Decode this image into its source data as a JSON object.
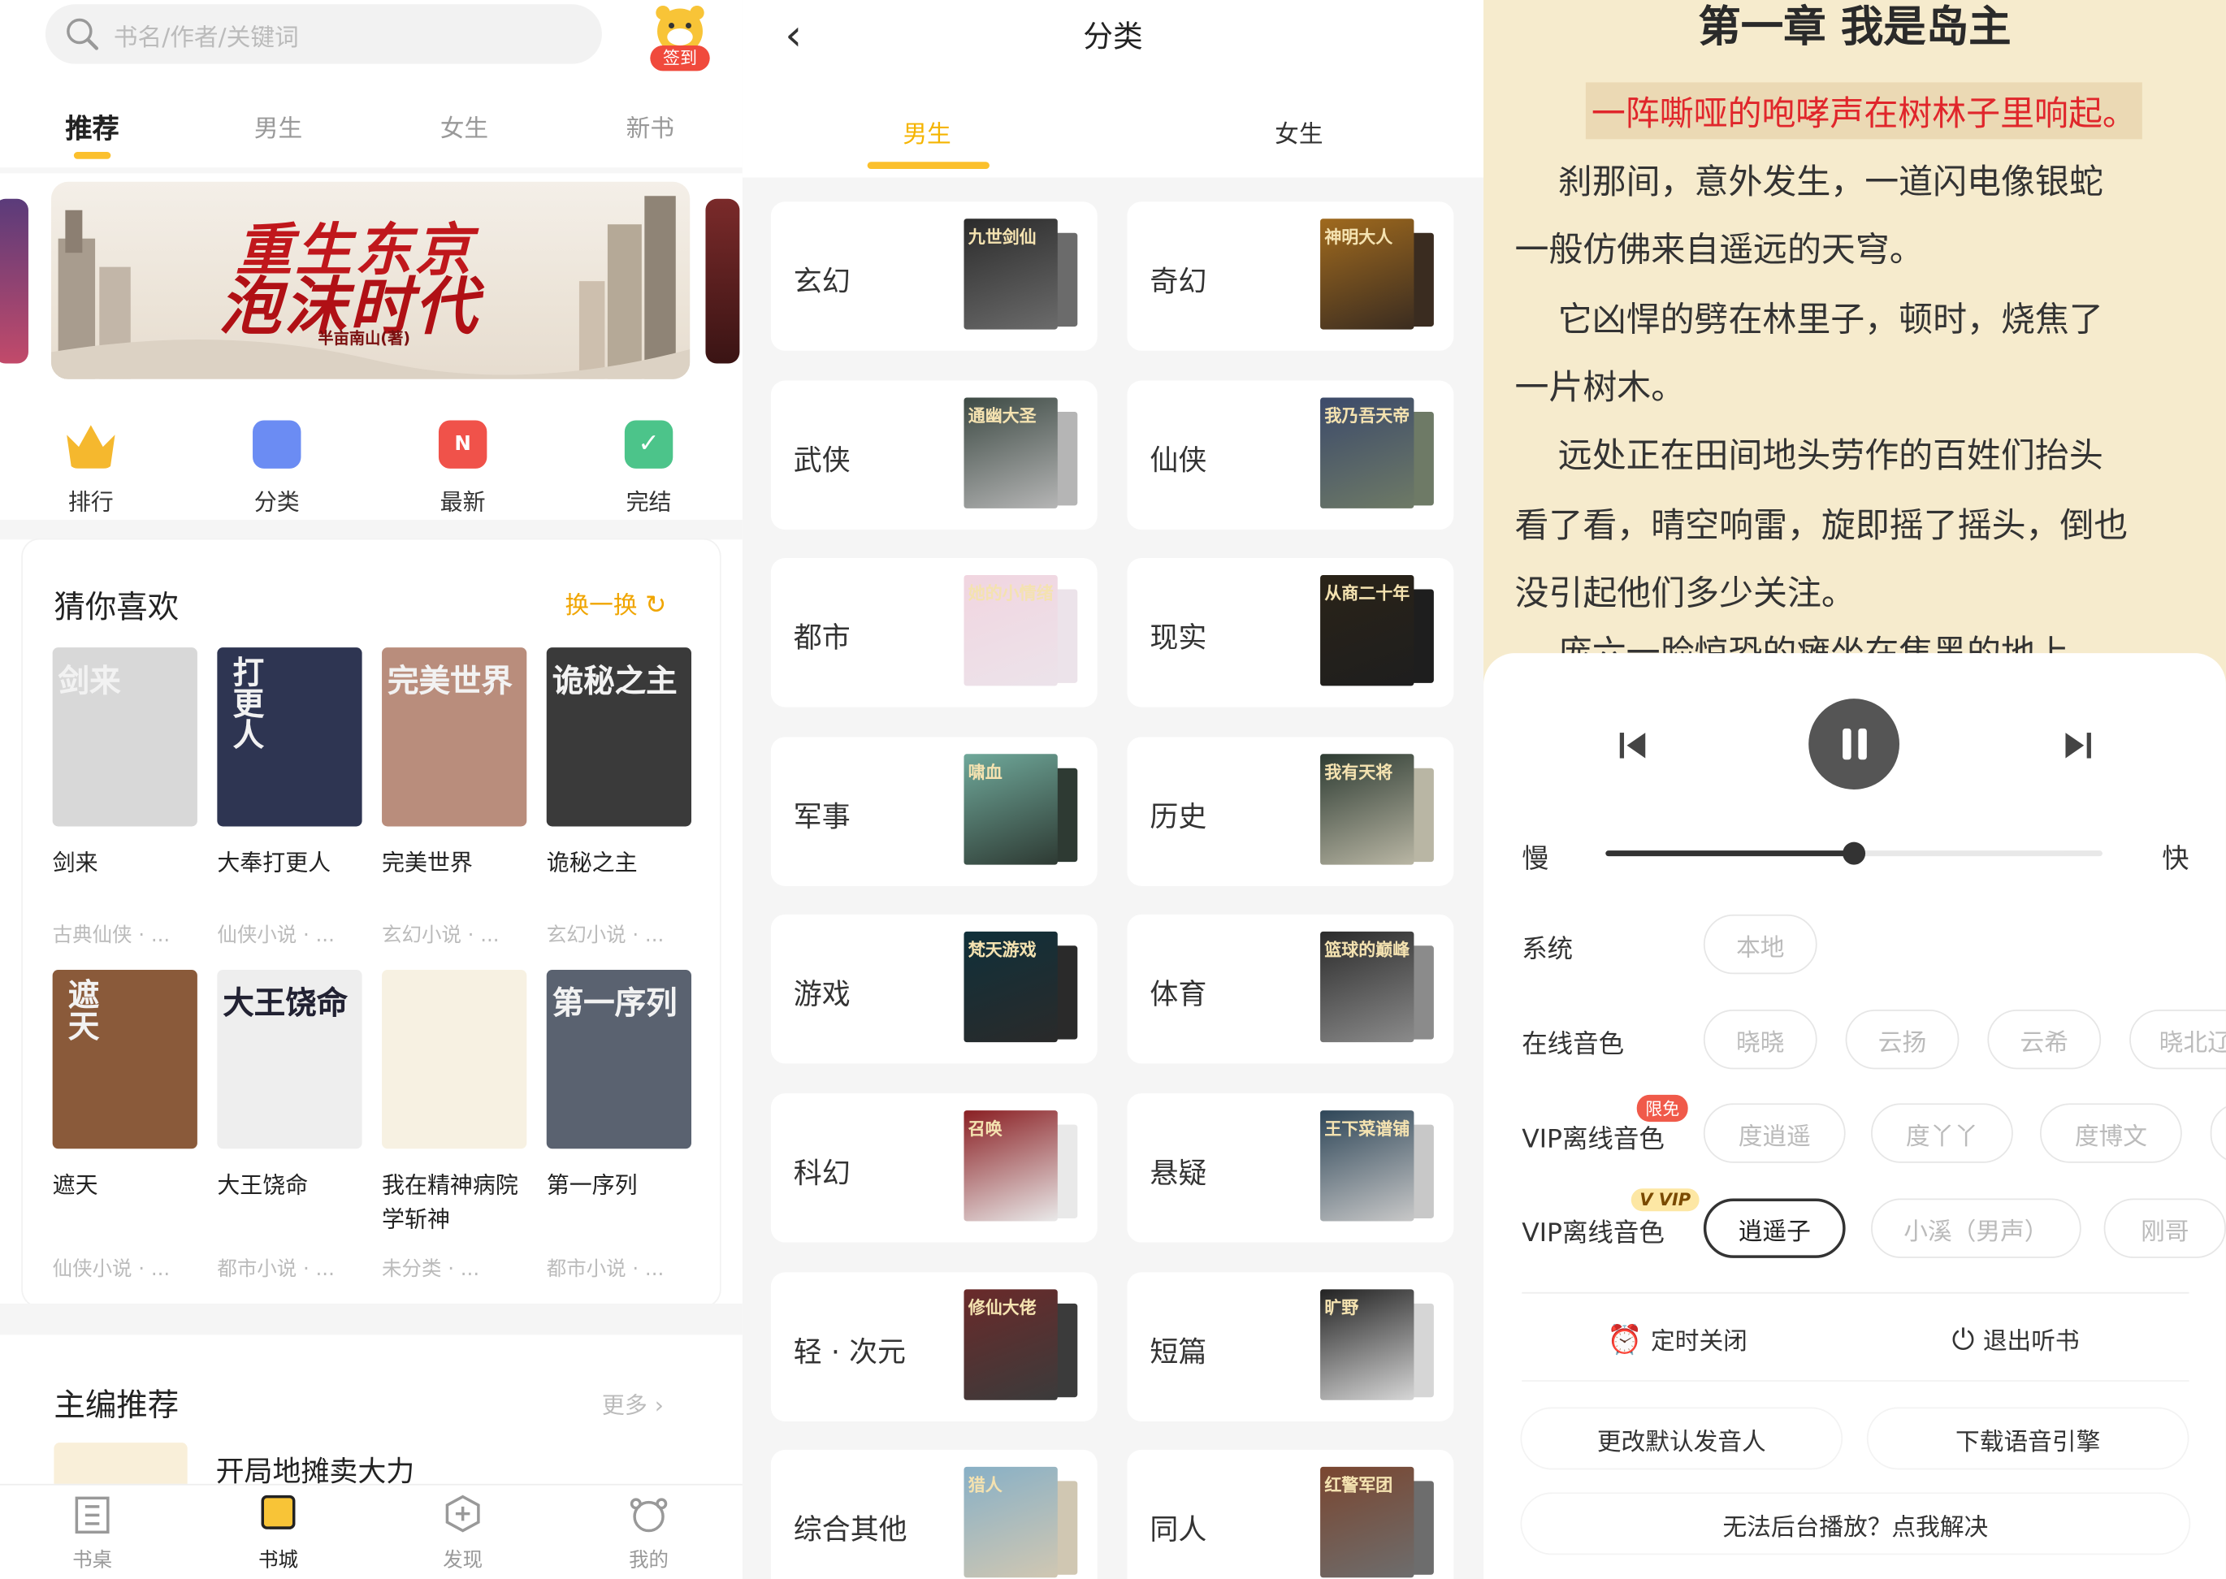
{
  "bookstore": {
    "search_placeholder": "书名/作者/关键词",
    "signin_label": "签到",
    "tabs": [
      "推荐",
      "男生",
      "女生",
      "新书"
    ],
    "banner_title_line1": "重生东京",
    "banner_title_line2": "泡沫时代",
    "banner_author": "半亩南山(著)",
    "quick_links": [
      {
        "label": "排行",
        "icon": "crown-icon",
        "color": "#f5b82e"
      },
      {
        "label": "分类",
        "icon": "category-icon",
        "color": "#6b8cf3"
      },
      {
        "label": "最新",
        "icon": "new-icon",
        "color": "#f0524a"
      },
      {
        "label": "完结",
        "icon": "check-icon",
        "color": "#4cc48a"
      }
    ],
    "guess_title": "猜你喜欢",
    "swap_label": "换一换",
    "books": [
      {
        "title": "剑来",
        "tag": "古典仙侠 · ...",
        "cover_text": "剑来",
        "cover_color": "#d8d8d8"
      },
      {
        "title": "大奉打更人",
        "tag": "仙侠小说 · ...",
        "cover_text": "打更人",
        "cover_color": "#2e3552"
      },
      {
        "title": "完美世界",
        "tag": "玄幻小说 · ...",
        "cover_text": "完美世界",
        "cover_color": "#b98d7c"
      },
      {
        "title": "诡秘之主",
        "tag": "玄幻小说 · ...",
        "cover_text": "诡秘之主",
        "cover_color": "#3a3a3a"
      },
      {
        "title": "遮天",
        "tag": "仙侠小说 · ...",
        "cover_text": "遮天",
        "cover_color": "#8a5a3a"
      },
      {
        "title": "大王饶命",
        "tag": "都市小说 · ...",
        "cover_text": "大王饶命",
        "cover_color": "#eeeeee"
      },
      {
        "title": "我在精神病院学斩神",
        "tag": "未分类 · ...",
        "cover_text": "",
        "cover_color": "#f7f1e2"
      },
      {
        "title": "第一序列",
        "tag": "都市小说 · ...",
        "cover_text": "第一序列",
        "cover_color": "#5a6270"
      }
    ],
    "editor_title": "主编推荐",
    "more_label": "更多",
    "editor_book_title": "开局地摊卖大力",
    "bottom_tabs": [
      "书桌",
      "书城",
      "发现",
      "我的"
    ]
  },
  "category": {
    "title": "分类",
    "tabs": [
      "男生",
      "女生"
    ],
    "items": [
      {
        "name": "玄幻",
        "cover_text": "九世剑仙",
        "c1": "#2b2b2b",
        "c2": "#6b6b6b"
      },
      {
        "name": "奇幻",
        "cover_text": "神明大人",
        "c1": "#a06a1e",
        "c2": "#3a2c20"
      },
      {
        "name": "武侠",
        "cover_text": "通幽大圣",
        "c1": "#3d4a44",
        "c2": "#b5b5b5"
      },
      {
        "name": "仙侠",
        "cover_text": "我乃吾天帝",
        "c1": "#3c4a6a",
        "c2": "#6e7a66"
      },
      {
        "name": "都市",
        "cover_text": "她的小情绪",
        "c1": "#f1d5e0",
        "c2": "#ece3ea"
      },
      {
        "name": "现实",
        "cover_text": "从商二十年",
        "c1": "#2a2318",
        "c2": "#1e1e1e"
      },
      {
        "name": "军事",
        "cover_text": "啸血",
        "c1": "#6fa89a",
        "c2": "#2e3a33"
      },
      {
        "name": "历史",
        "cover_text": "我有天将",
        "c1": "#2d3b32",
        "c2": "#b9b6a4"
      },
      {
        "name": "游戏",
        "cover_text": "梵天游戏",
        "c1": "#10303a",
        "c2": "#2a2a2a"
      },
      {
        "name": "体育",
        "cover_text": "篮球的巅峰",
        "c1": "#2b2b2b",
        "c2": "#8b8b8b"
      },
      {
        "name": "科幻",
        "cover_text": "召唤",
        "c1": "#8a1f23",
        "c2": "#e9e9e9"
      },
      {
        "name": "悬疑",
        "cover_text": "王下菜谱铺",
        "c1": "#2e4658",
        "c2": "#c8c8c8"
      },
      {
        "name": "轻 · 次元",
        "cover_text": "修仙大佬",
        "c1": "#6a2a2a",
        "c2": "#3b3b3b"
      },
      {
        "name": "短篇",
        "cover_text": "旷野",
        "c1": "#222222",
        "c2": "#d6d6d6"
      },
      {
        "name": "综合其他",
        "cover_text": "猎人",
        "c1": "#88b0c6",
        "c2": "#d0c7b2"
      },
      {
        "name": "同人",
        "cover_text": "红警军团",
        "c1": "#7a4630",
        "c2": "#6d6d6d"
      }
    ]
  },
  "reader": {
    "chapter_title": "第一章 我是岛主",
    "highlight_line": "一阵嘶哑的咆哮声在树林子里响起。",
    "lines": [
      "    刹那间，意外发生，一道闪电像银蛇",
      "一般仿佛来自遥远的天穹。",
      "    它凶悍的劈在林里子，顿时，烧焦了",
      "一片树木。",
      "    远处正在田间地头劳作的百姓们抬头",
      "看了看，晴空响雷，旋即摇了摇头，倒也",
      "没引起他们多少关注。"
    ],
    "cut_line": "    庞六一脸惊恐的瘫坐在焦黑的地上，",
    "speed_slow": "慢",
    "speed_fast": "快",
    "speed_level": 0.5,
    "system_label": "系统",
    "system_options": [
      "本地"
    ],
    "online_label": "在线音色",
    "online_voices": [
      "晓晓",
      "云扬",
      "云希",
      "晓北辽"
    ],
    "vip1_label": "VIP离线音色",
    "vip1_badge": "限免",
    "vip1_voices": [
      "度逍遥",
      "度丫丫",
      "度博文",
      ""
    ],
    "vip2_label": "VIP离线音色",
    "vip2_badge": "V VIP",
    "vip2_voices": [
      "逍遥子",
      "小溪（男声）",
      "刚哥"
    ],
    "timer_label": "定时关闭",
    "exit_label": "退出听书",
    "change_voice_label": "更改默认发音人",
    "download_label": "下载语音引擎",
    "background_help_label": "无法后台播放？点我解决"
  }
}
